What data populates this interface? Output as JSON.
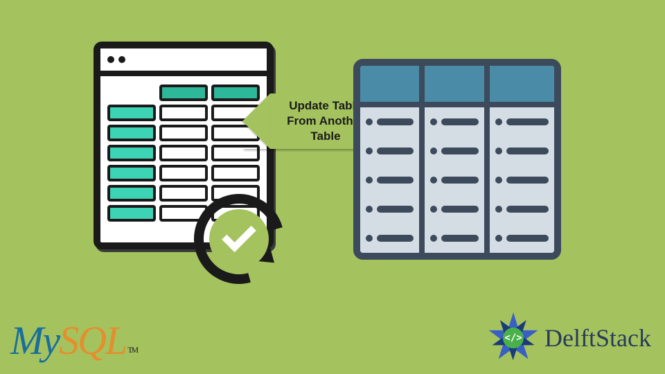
{
  "arrow": {
    "label": "Update Table From Another Table"
  },
  "mysql": {
    "my": "My",
    "sql": "SQL",
    "tm": "TM"
  },
  "delftstack": {
    "text": "DelftStack",
    "code": "</>"
  }
}
